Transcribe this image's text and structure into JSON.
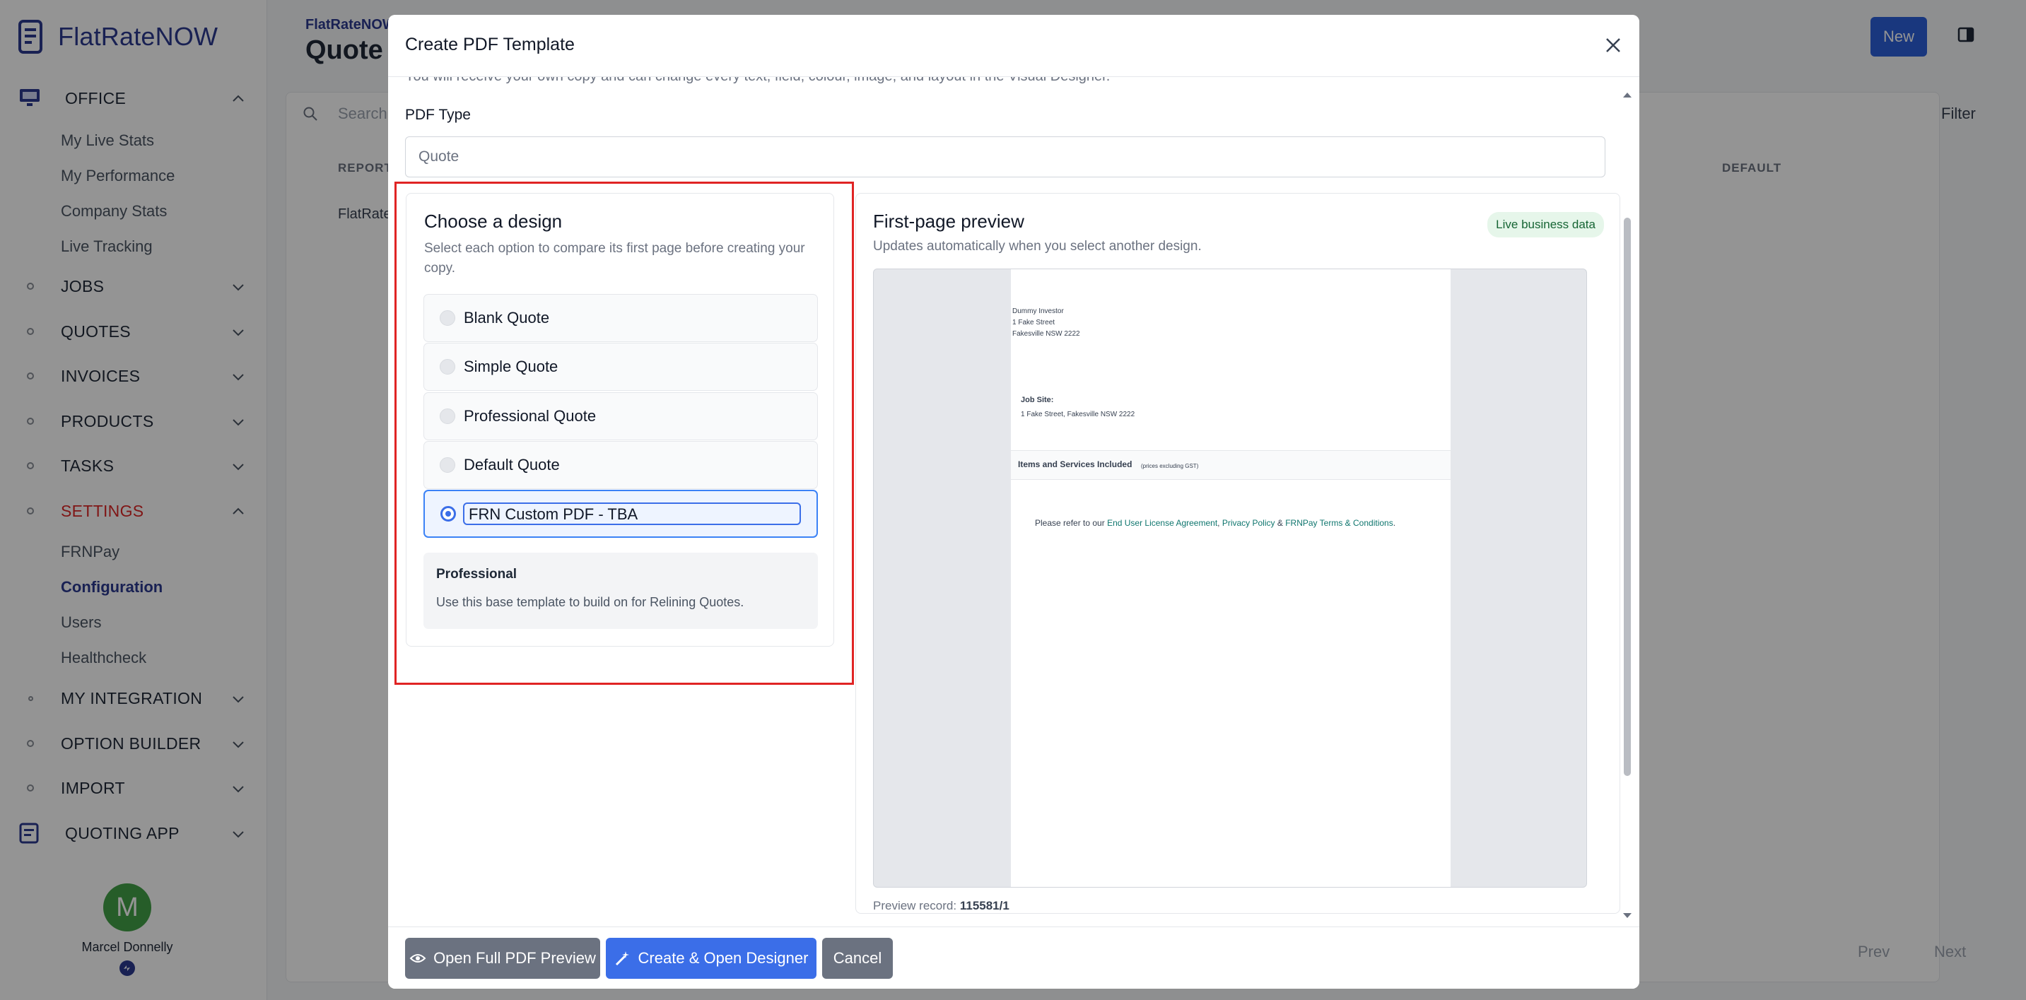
{
  "sidebar": {
    "brand": "FlatRateNOW",
    "office": {
      "label": "OFFICE",
      "items": [
        "My Live Stats",
        "My Performance",
        "Company Stats",
        "Live Tracking"
      ]
    },
    "sections": {
      "jobs": "JOBS",
      "quotes": "QUOTES",
      "invoices": "INVOICES",
      "products": "PRODUCTS",
      "tasks": "TASKS"
    },
    "settings": {
      "label": "SETTINGS",
      "items": [
        "FRNPay",
        "Configuration",
        "Users",
        "Healthcheck"
      ]
    },
    "more": {
      "integration": "MY INTEGRATION",
      "option_builder": "OPTION BUILDER",
      "import": "IMPORT",
      "quoting_app": "QUOTING APP"
    },
    "user": {
      "initial": "M",
      "name": "Marcel Donnelly"
    }
  },
  "background": {
    "breadcrumb": "FlatRateNOW",
    "title": "Quote",
    "new_label": "New",
    "search_placeholder": "Search...",
    "filter_label": "Filter",
    "col_report": "REPORT",
    "col_default": "DEFAULT",
    "row_cell": "FlatRateI",
    "prev": "Prev",
    "next": "Next"
  },
  "modal": {
    "title": "Create PDF Template",
    "intro": "You will receive your own copy and can change every text, field, colour, image, and layout in the Visual Designer.",
    "pdf_type_label": "PDF Type",
    "pdf_type_value": "Quote",
    "design": {
      "title": "Choose a design",
      "subtitle": "Select each option to compare its first page before creating your copy.",
      "options": [
        "Blank Quote",
        "Simple Quote",
        "Professional Quote",
        "Default Quote",
        "FRN Custom PDF - TBA"
      ],
      "selected_index": 4,
      "info_title": "Professional",
      "info_desc": "Use this base template to build on for Relining Quotes."
    },
    "preview": {
      "title": "First-page preview",
      "subtitle": "Updates automatically when you select another design.",
      "badge": "Live business data",
      "addr1": "Dummy Investor",
      "addr2": "1 Fake Street",
      "addr3": "Fakesville NSW 2222",
      "job_site_label": "Job Site:",
      "job_site_value": "1 Fake Street, Fakesville NSW 2222",
      "section_title": "Items and Services Included",
      "section_note": "(prices excluding GST)",
      "refer_prefix": "Please refer to our",
      "link_eula": "End User License Agreement",
      "link_privacy": "Privacy Policy",
      "amp": "&",
      "link_terms": "FRNPay Terms & Conditions",
      "record_label": "Preview record:",
      "record_value": "115581/1"
    },
    "footer": {
      "open_preview": "Open Full PDF Preview",
      "create_open": "Create & Open Designer",
      "cancel": "Cancel"
    }
  },
  "colors": {
    "brand": "#2b3990",
    "primary": "#3b6ee8",
    "highlight": "#e02424",
    "settings": "#dc2626"
  }
}
